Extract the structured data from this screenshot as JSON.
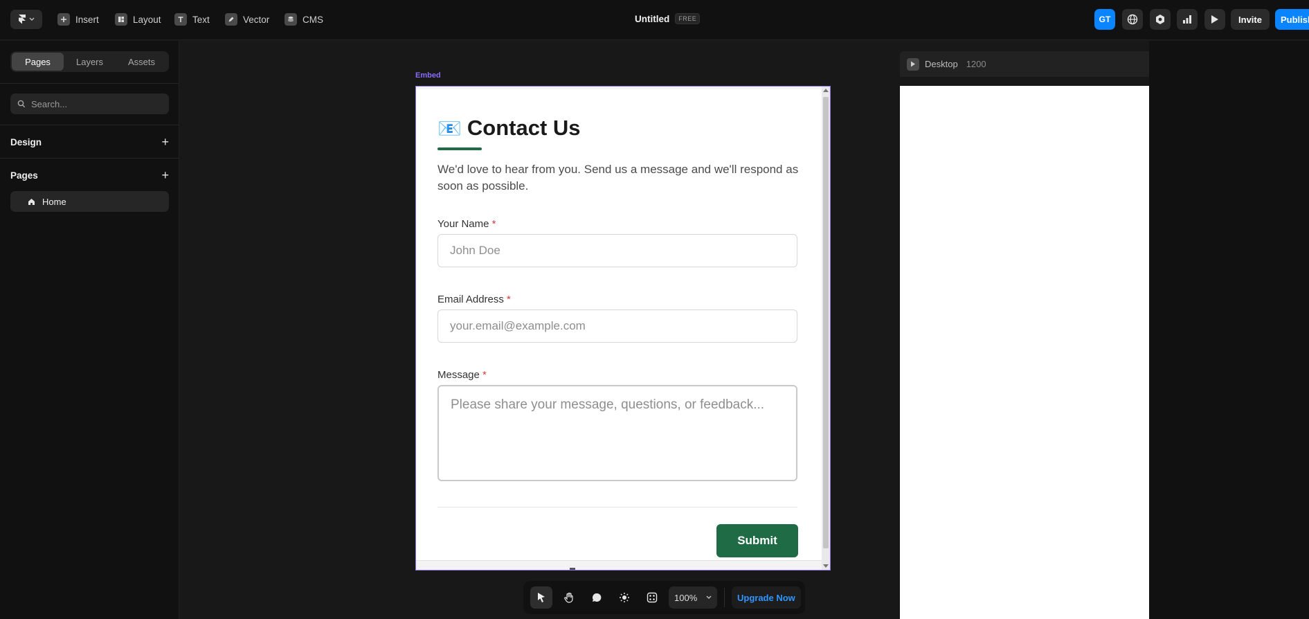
{
  "topbar": {
    "tools": [
      {
        "label": "Insert",
        "icon": "plus-icon"
      },
      {
        "label": "Layout",
        "icon": "layout-icon"
      },
      {
        "label": "Text",
        "icon": "text-icon"
      },
      {
        "label": "Vector",
        "icon": "pen-icon"
      },
      {
        "label": "CMS",
        "icon": "database-icon"
      }
    ],
    "title": "Untitled",
    "badge": "FREE",
    "avatar": "GT",
    "invite": "Invite",
    "publish": "Publish"
  },
  "sidebar": {
    "tabs": [
      "Pages",
      "Layers",
      "Assets"
    ],
    "search_placeholder": "Search...",
    "design_label": "Design",
    "pages_label": "Pages",
    "page_item": "Home"
  },
  "canvas": {
    "embed_label": "Embed",
    "form": {
      "emoji": "📧",
      "title": "Contact Us",
      "description": "We'd love to hear from you. Send us a message and we'll respond as soon as possible.",
      "fields": [
        {
          "label": "Your Name",
          "placeholder": "John Doe"
        },
        {
          "label": "Email Address",
          "placeholder": "your.email@example.com"
        },
        {
          "label": "Message",
          "placeholder": "Please share your message, questions, or feedback..."
        }
      ],
      "required_mark": "*",
      "submit": "Submit"
    }
  },
  "preview": {
    "device": "Desktop",
    "width": "1200"
  },
  "bottom_toolbar": {
    "zoom": "100%",
    "upgrade": "Upgrade Now"
  },
  "colors": {
    "accent_blue": "#0a84ff",
    "frame_purple": "#8a6cf7",
    "submit_green": "#1e6b45",
    "required_red": "#d23b3b"
  }
}
